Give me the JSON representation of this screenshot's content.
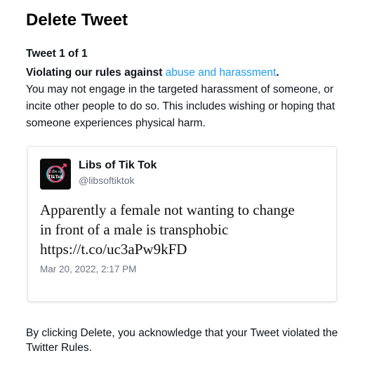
{
  "header": {
    "title": "Delete Tweet",
    "counter": "Tweet 1 of 1"
  },
  "violation": {
    "lead": "Violating our rules against ",
    "policy_link": "abuse and harassment",
    "period": ".",
    "description": "You may not engage in the targeted harassment of someone, or incite other people to do so. This includes wishing or hoping that someone experiences physical harm."
  },
  "tweet": {
    "display_name": "Libs of Tik Tok",
    "handle": "@libsoftiktok",
    "avatar_text": [
      "Libs of",
      "TikTok"
    ],
    "text_lines": [
      "Apparently a female not wanting to change",
      "in front of a male is transphobic",
      "https://t.co/uc3aPw9kFD"
    ],
    "timestamp": "Mar 20, 2022, 2:17 PM"
  },
  "footer": {
    "notice": "By clicking Delete, you acknowledge that your Tweet violated the Twitter Rules."
  },
  "colors": {
    "link": "#1d9bf0",
    "text": "#0f1419",
    "muted": "#6b7280",
    "avatar_bg": "#0a0a0a",
    "avatar_ring": "#e8416b",
    "avatar_ring_alt": "#25d3e0"
  }
}
